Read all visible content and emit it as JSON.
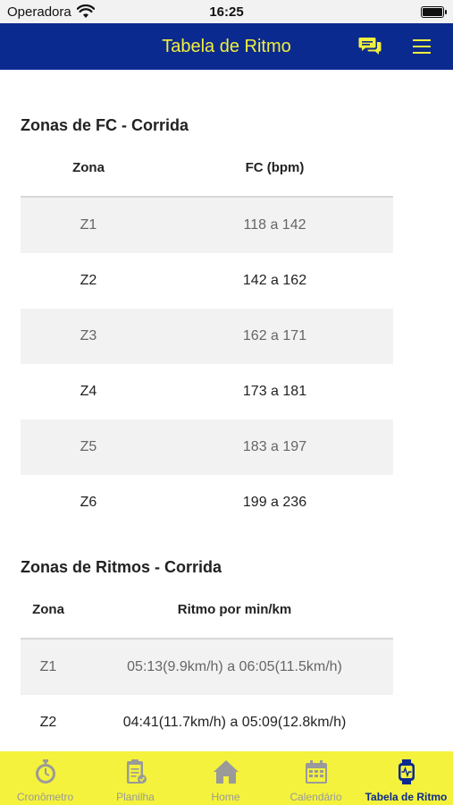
{
  "status_bar": {
    "carrier": "Operadora",
    "time": "16:25"
  },
  "header": {
    "title": "Tabela de Ritmo",
    "chat_icon": "chat-icon",
    "menu_icon": "menu-icon"
  },
  "fc_section": {
    "title": "Zonas de FC - Corrida",
    "headers": [
      "Zona",
      "FC (bpm)"
    ],
    "rows": [
      [
        "Z1",
        "118 a 142"
      ],
      [
        "Z2",
        "142 a 162"
      ],
      [
        "Z3",
        "162 a 171"
      ],
      [
        "Z4",
        "173 a 181"
      ],
      [
        "Z5",
        "183 a 197"
      ],
      [
        "Z6",
        "199 a 236"
      ]
    ]
  },
  "ritmo_section": {
    "title": "Zonas de Ritmos - Corrida",
    "headers": [
      "Zona",
      "Ritmo por min/km"
    ],
    "rows": [
      [
        "Z1",
        "05:13(9.9km/h) a 06:05(11.5km/h)"
      ],
      [
        "Z2",
        "04:41(11.7km/h) a 05:09(12.8km/h)"
      ]
    ]
  },
  "tab_bar": {
    "tabs": [
      {
        "label": "Cronômetro",
        "icon": "stopwatch-icon"
      },
      {
        "label": "Planilha",
        "icon": "clipboard-icon"
      },
      {
        "label": "Home",
        "icon": "home-icon"
      },
      {
        "label": "Calendário",
        "icon": "calendar-icon"
      },
      {
        "label": "Tabela de Ritmo",
        "icon": "smartwatch-icon",
        "active": true
      }
    ]
  },
  "colors": {
    "header_bg": "#0b2a8f",
    "accent_yellow": "#f2ef3d",
    "tabbar_bg": "#f4f23c",
    "inactive_tab": "#9a9a9a"
  }
}
